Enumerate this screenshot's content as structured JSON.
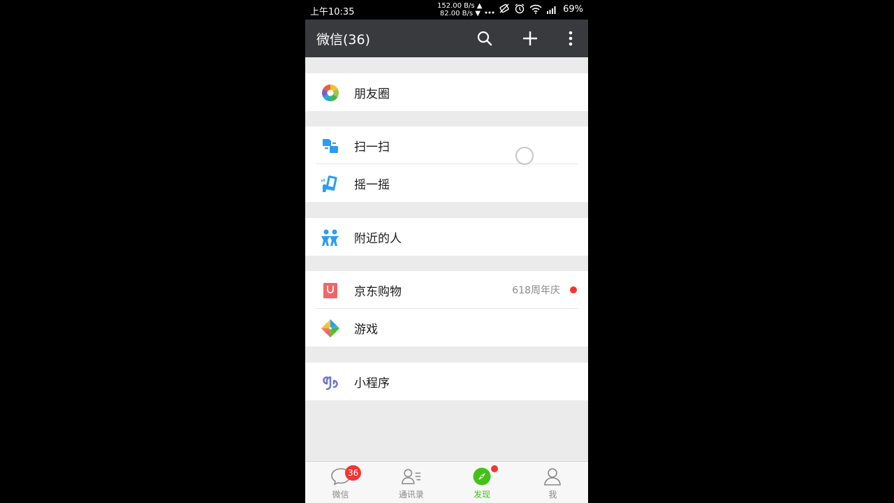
{
  "status_bar": {
    "time": "上午10:35",
    "upload_speed": "152.00 B/s ▲",
    "download_speed": "82.00 B/s ▼",
    "icons": [
      "more-dots-icon",
      "rotation-off-icon",
      "alarm-icon",
      "wifi-icon",
      "signal-icon"
    ],
    "battery": "69%"
  },
  "header": {
    "title": "微信(36)",
    "actions": [
      "search-icon",
      "add-icon",
      "more-vert-icon"
    ]
  },
  "menu": {
    "moments": {
      "label": "朋友圈",
      "icon": "moments-icon"
    },
    "scan": {
      "label": "扫一扫",
      "icon": "scan-icon"
    },
    "shake": {
      "label": "摇一摇",
      "icon": "shake-icon"
    },
    "nearby": {
      "label": "附近的人",
      "icon": "people-nearby-icon"
    },
    "jd": {
      "label": "京东购物",
      "icon": "jd-shopping-icon",
      "extra": "618周年庆",
      "has_dot": true
    },
    "games": {
      "label": "游戏",
      "icon": "games-icon"
    },
    "mini_programs": {
      "label": "小程序",
      "icon": "mini-program-icon"
    }
  },
  "bottom_nav": {
    "chats": {
      "label": "微信",
      "badge": "36",
      "icon": "chat-bubble-icon"
    },
    "contacts": {
      "label": "通讯录",
      "icon": "contacts-icon"
    },
    "discover": {
      "label": "发现",
      "icon": "compass-icon",
      "active": true,
      "has_dot": true
    },
    "me": {
      "label": "我",
      "icon": "person-icon"
    }
  },
  "colors": {
    "header_bg": "#393a3e",
    "accent_green": "#45c01a",
    "badge_red": "#f43530",
    "page_bg": "#ebebeb"
  }
}
